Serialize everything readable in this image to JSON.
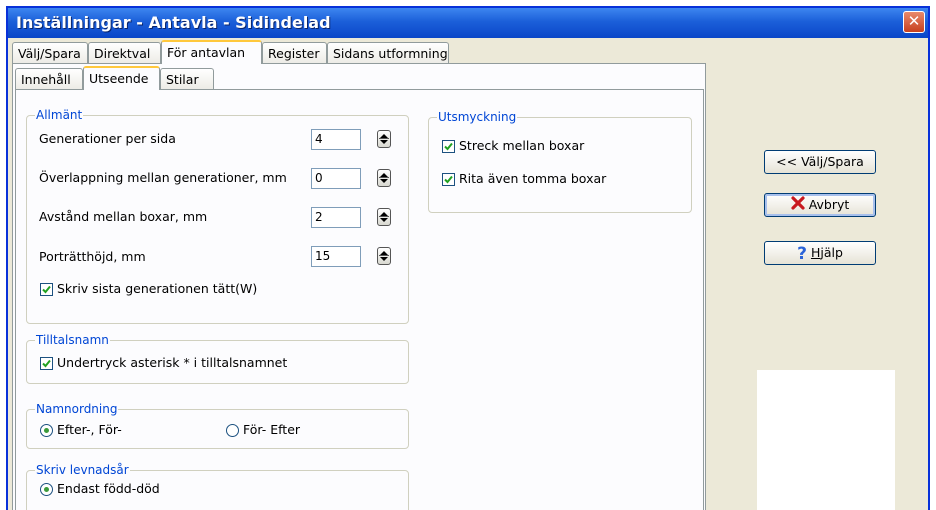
{
  "window": {
    "title": "Inställningar - Antavla - Sidindelad",
    "close_glyph": "✕"
  },
  "tabs_top": [
    "Välj/Spara",
    "Direktval",
    "För antavlan",
    "Register",
    "Sidans utformning"
  ],
  "tabs_sub": [
    "Innehåll",
    "Utseende",
    "Stilar"
  ],
  "general": {
    "legend": "Allmänt",
    "fields": [
      {
        "label": "Generationer per sida",
        "value": "4"
      },
      {
        "label": "Överlappning mellan generationer, mm",
        "value": "0"
      },
      {
        "label": "Avstånd mellan boxar, mm",
        "value": "2"
      },
      {
        "label": "Porträtthöjd, mm",
        "value": "15"
      }
    ],
    "checkbox_label": "Skriv sista generationen tätt(W)",
    "checkbox_checked": true
  },
  "nickname": {
    "legend": "Tilltalsnamn",
    "checkbox_label": "Undertryck asterisk * i tilltalsnamnet",
    "checkbox_checked": true
  },
  "name_order": {
    "legend": "Namnordning",
    "options": [
      "Efter-, För-",
      "För- Efter"
    ],
    "selected": 0
  },
  "years": {
    "legend": "Skriv levnadsår",
    "options": [
      "Endast född-död"
    ],
    "selected": 0
  },
  "decoration": {
    "legend": "Utsmyckning",
    "checkboxes": [
      {
        "label": "Streck mellan boxar",
        "checked": true
      },
      {
        "label": "Rita även tomma boxar",
        "checked": true
      }
    ]
  },
  "buttons": {
    "choose_save": "<< Välj/Spara",
    "cancel": "Avbryt",
    "help_prefix": "H",
    "help_rest": "jälp",
    "cancel_icon": "red-x-icon",
    "help_icon": "question-mark-icon"
  },
  "colors": {
    "title_bar": "#1b5fd9",
    "legend_text": "#0046d5",
    "active_tab_accent": "#ffc83c",
    "check_green": "#21a121"
  }
}
